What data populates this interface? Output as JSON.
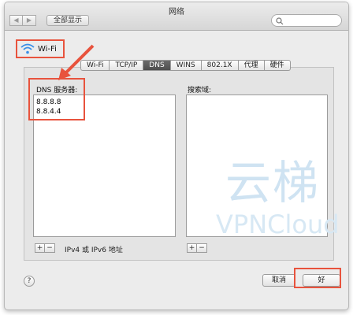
{
  "window": {
    "title": "网络",
    "nav_back": "◀",
    "nav_forward": "▶",
    "show_all": "全部显示"
  },
  "wifi": {
    "label": "Wi-Fi"
  },
  "tabs": [
    {
      "label": "Wi-Fi",
      "active": false
    },
    {
      "label": "TCP/IP",
      "active": false
    },
    {
      "label": "DNS",
      "active": true
    },
    {
      "label": "WINS",
      "active": false
    },
    {
      "label": "802.1X",
      "active": false
    },
    {
      "label": "代理",
      "active": false
    },
    {
      "label": "硬件",
      "active": false
    }
  ],
  "dns": {
    "label": "DNS 服务器:",
    "servers": [
      "8.8.8.8",
      "8.8.4.4"
    ],
    "note": "IPv4 或 IPv6 地址"
  },
  "search_domains": {
    "label": "搜索域:"
  },
  "buttons": {
    "add": "+",
    "remove": "−",
    "help": "?",
    "cancel": "取消",
    "ok": "好"
  },
  "watermark": {
    "title": "云梯",
    "subtitle": "VPNCloud"
  },
  "colors": {
    "highlight": "#e8533d",
    "wifi": "#3a8ee6"
  }
}
